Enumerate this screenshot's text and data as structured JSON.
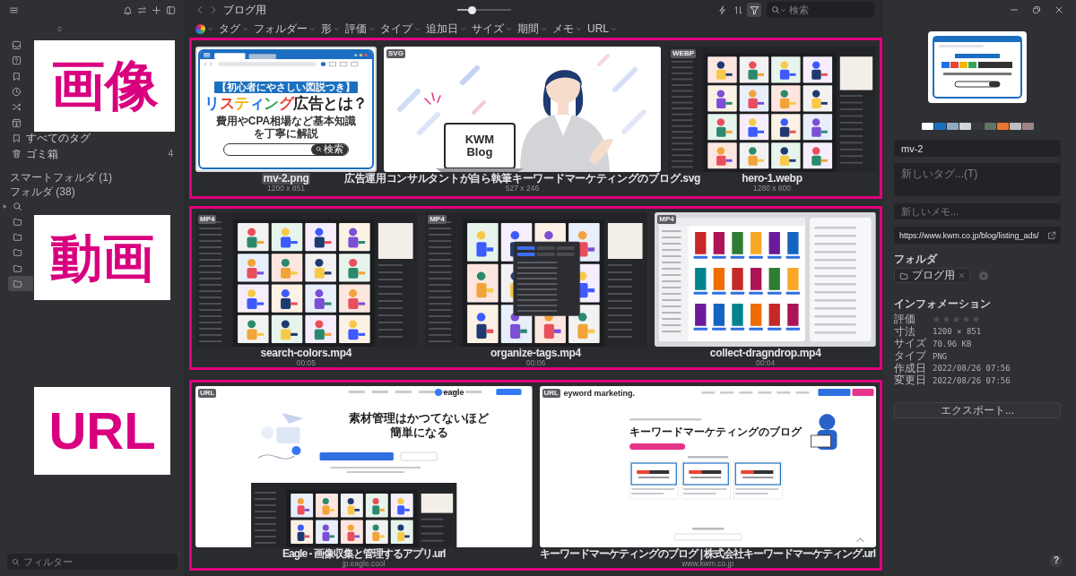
{
  "sidebar": {
    "nav": [
      {
        "kind": "inbox"
      },
      {
        "kind": "unfiled"
      },
      {
        "kind": "bookmarks"
      },
      {
        "kind": "recent"
      },
      {
        "kind": "random"
      },
      {
        "kind": "import"
      },
      {
        "kind": "tags",
        "label": "すべてのタグ"
      },
      {
        "kind": "trash",
        "label": "ゴミ箱",
        "count": "4"
      }
    ],
    "smart_folders": {
      "label": "スマートフォルダ (1)"
    },
    "folders": {
      "label": "フォルダ (38)",
      "items": [
        {
          "kind": "search",
          "expanded": false,
          "selected": false
        },
        {
          "kind": "folder",
          "selected": false
        },
        {
          "kind": "folder",
          "selected": false
        },
        {
          "kind": "folder",
          "selected": false
        },
        {
          "kind": "folder",
          "selected": false
        },
        {
          "kind": "folder",
          "selected": true
        }
      ]
    },
    "filter": {
      "placeholder": "フィルター"
    }
  },
  "toolbar": {
    "title": "ブログ用",
    "zoom": {
      "level": 0.28
    },
    "tools": [
      {
        "kind": "bolt",
        "selected": false
      },
      {
        "kind": "sort",
        "selected": false
      },
      {
        "kind": "filter",
        "selected": true
      }
    ],
    "search": {
      "placeholder": "検索"
    }
  },
  "filter_bar": [
    {
      "kind": "color"
    },
    {
      "kind": "text",
      "label": "タグ"
    },
    {
      "kind": "text",
      "label": "フォルダー"
    },
    {
      "kind": "text",
      "label": "形"
    },
    {
      "kind": "text",
      "label": "評価"
    },
    {
      "kind": "text",
      "label": "タイプ"
    },
    {
      "kind": "text",
      "label": "追加日"
    },
    {
      "kind": "text",
      "label": "サイズ"
    },
    {
      "kind": "text",
      "label": "期間"
    },
    {
      "kind": "text",
      "label": "メモ"
    },
    {
      "kind": "text",
      "label": "URL"
    }
  ],
  "groups": [
    {
      "label": "画像",
      "items": [
        {
          "kind": "banner",
          "name": "mv-2.png",
          "detail": "1200 x 851",
          "selected": true,
          "art": {
            "tag": "【初心者にやさしい図説つき】",
            "title": [
              {
                "text": "リスティング",
                "accent": true
              },
              {
                "text": "広告とは？",
                "accent": false
              }
            ],
            "subtitle": "費用やCPA相場など基本知識を丁寧に解説",
            "button": "検索"
          }
        },
        {
          "kind": "illustration",
          "badge": "SVG",
          "name": "広告運用コンサルタントが自ら執筆キーワードマーケティングのブログ.svg",
          "detail": "527 x 246",
          "selected": false,
          "art": {
            "screen_text": [
              "KWM",
              "Blog"
            ]
          }
        },
        {
          "kind": "app-grid",
          "badge": "WEBP",
          "name": "hero-1.webp",
          "detail": "1280 x 800",
          "selected": false
        }
      ]
    },
    {
      "label": "動画",
      "items": [
        {
          "kind": "app-grid",
          "badge": "MP4",
          "name": "search-colors.mp4",
          "detail": "00:05",
          "selected": false
        },
        {
          "kind": "app-menu",
          "badge": "MP4",
          "name": "organize-tags.mp4",
          "detail": "00:06",
          "selected": false
        },
        {
          "kind": "app-finder",
          "badge": "MP4",
          "name": "collect-dragndrop.mp4",
          "detail": "00:04",
          "selected": false
        }
      ]
    },
    {
      "label": "URL",
      "items": [
        {
          "kind": "landing",
          "badge": "URL",
          "name": "Eagle - 画像収集と管理するアプリ.url",
          "detail": "jp.eagle.cool",
          "selected": false,
          "art": {
            "logo": "eagle",
            "headline": "素材管理はかつてないほど簡単になる"
          }
        },
        {
          "kind": "blog",
          "badge": "URL",
          "name": "キーワードマーケティングのブログ | 株式会社キーワードマーケティング.url",
          "detail": "www.kwm.co.jp",
          "selected": false,
          "art": {
            "logo": "eyword marketing.",
            "headline": "キーワードマーケティングのブログ"
          }
        }
      ]
    }
  ],
  "inspector": {
    "palette": [
      {
        "color": "#ffffff"
      },
      {
        "color": "#1a6fbf"
      },
      {
        "color": "#8fabc0"
      },
      {
        "color": "#d2d5d9"
      },
      {
        "color": "#38393c"
      },
      {
        "color": "#5f7562"
      },
      {
        "color": "#e8762c"
      },
      {
        "color": "#bdbec0"
      },
      {
        "color": "#9c8485"
      }
    ],
    "name": {
      "value": "mv-2"
    },
    "tags": {
      "placeholder": "新しいタグ...(T)"
    },
    "memo": {
      "placeholder": "新しいメモ..."
    },
    "url": {
      "value": "https://www.kwm.co.jp/blog/listing_ads/"
    },
    "folders": {
      "label": "フォルダ",
      "items": [
        {
          "label": "ブログ用"
        }
      ]
    },
    "info": {
      "title": "インフォメーション",
      "rows": [
        {
          "kind": "stars",
          "label": "評価",
          "stars": 0
        },
        {
          "kind": "text",
          "label": "寸法",
          "value": "1200 × 851"
        },
        {
          "kind": "text",
          "label": "サイズ",
          "value": "70.96 KB"
        },
        {
          "kind": "text",
          "label": "タイプ",
          "value": "PNG"
        },
        {
          "kind": "text",
          "label": "作成日",
          "value": "2022/08/26 07:56"
        },
        {
          "kind": "text",
          "label": "変更日",
          "value": "2022/08/26 07:56"
        }
      ]
    },
    "export": "エクスポート..."
  },
  "help": "?"
}
